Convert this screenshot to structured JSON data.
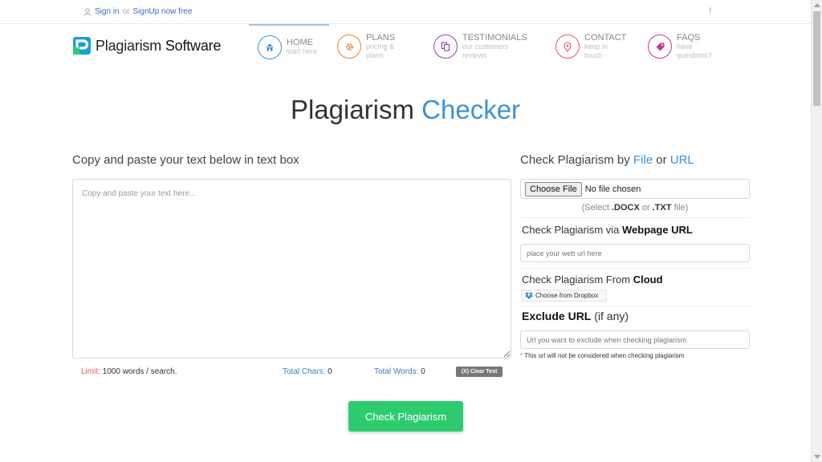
{
  "topbar": {
    "sign_in": "Sign in",
    "or": "or",
    "signup": "SignUp now free",
    "facebook": "f"
  },
  "brand": {
    "name_part1": "Plagiarism",
    "name_part2": "Software"
  },
  "nav": {
    "items": [
      {
        "title": "HOME",
        "subtitle": "start here",
        "icon": "home-icon",
        "color": "#3d93d6"
      },
      {
        "title": "PLANS",
        "subtitle": "pricing & plans",
        "icon": "gear-icon",
        "color": "#e8822c"
      },
      {
        "title": "TESTIMONIALS",
        "subtitle": "our customers reviews",
        "icon": "copy-icon",
        "color": "#8e44ad"
      },
      {
        "title": "CONTACT",
        "subtitle": "keep in touch",
        "icon": "map-pin-icon",
        "color": "#e05c5c"
      },
      {
        "title": "FAQS",
        "subtitle": "have questions?",
        "icon": "tag-icon",
        "color": "#c0399f"
      }
    ]
  },
  "page": {
    "title_part1": "Plagiarism",
    "title_part2": "Checker"
  },
  "left": {
    "heading": "Copy and paste your text below in text box",
    "textarea_placeholder": "Copy and paste your text here...",
    "limit_label": "Limit:",
    "limit_value": "1000 words / search.",
    "chars_label": "Total Chars:",
    "chars_value": "0",
    "words_label": "Total Words:",
    "words_value": "0",
    "clear_button": "(X) Clear Text",
    "check_button": "Check Plagiarism"
  },
  "right": {
    "heading_prefix": "Check Plagiarism by",
    "heading_file": "File",
    "heading_or": "or",
    "heading_url": "URL",
    "file_button": "Choose File",
    "file_status": "No file chosen",
    "file_hint_pre": "(Select",
    "file_hint_docx": ".DOCX",
    "file_hint_or": "or",
    "file_hint_txt": ".TXT",
    "file_hint_post": "file)",
    "webpage_prefix": "Check Plagiarism via",
    "webpage_bold": "Webpage URL",
    "webpage_placeholder": "place your web url here",
    "cloud_prefix": "Check Plagiarism From",
    "cloud_bold": "Cloud",
    "dropbox_button": "Choose from Dropbox",
    "exclude_bold": "Exclude URL",
    "exclude_suffix": "(if any)",
    "exclude_placeholder": "Url you want to exclude when checking plagiarism",
    "note_star": "*",
    "note_text": "This url will not be considered when checking plagiarism"
  },
  "colors": {
    "accent": "#3d93d6",
    "button_green": "#2ecc71",
    "limit_red": "#e06060"
  }
}
